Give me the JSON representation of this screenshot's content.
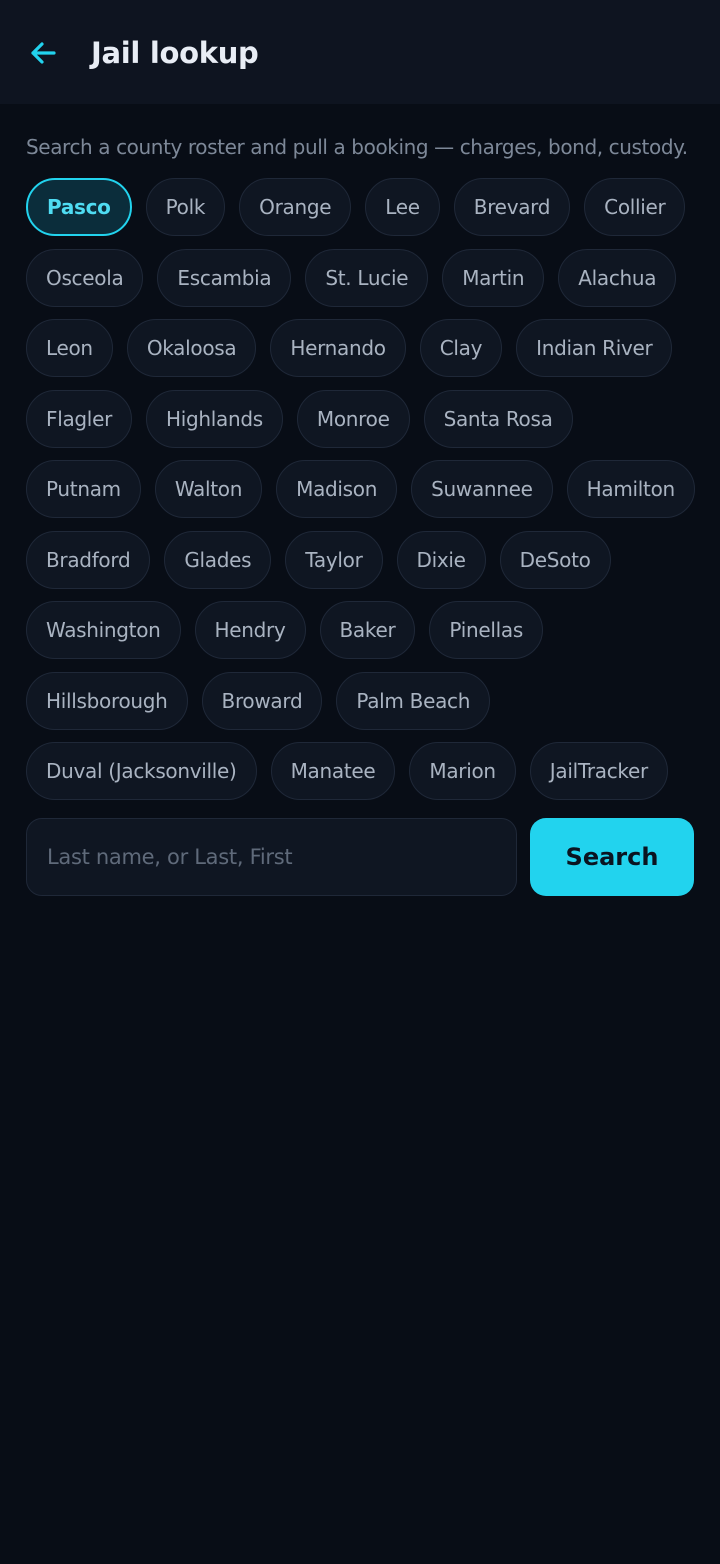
{
  "header": {
    "title": "Jail lookup",
    "back_icon": "arrow-left-icon",
    "accent_color": "#22d3ee"
  },
  "subtitle": "Search a county roster and pull a booking — charges, bond, custody.",
  "counties": {
    "selected": "Pasco",
    "rows": [
      [
        "Pasco",
        "Polk",
        "Orange",
        "Lee",
        "Brevard",
        "Collier"
      ],
      [
        "Osceola",
        "Escambia",
        "St. Lucie",
        "Martin",
        "Alachua"
      ],
      [
        "Leon",
        "Okaloosa",
        "Hernando",
        "Clay",
        "Indian River"
      ],
      [
        "Flagler",
        "Highlands",
        "Monroe",
        "Santa Rosa"
      ],
      [
        "Putnam",
        "Walton",
        "Madison",
        "Suwannee",
        "Hamilton"
      ],
      [
        "Bradford",
        "Glades",
        "Taylor",
        "Dixie",
        "DeSoto"
      ],
      [
        "Washington",
        "Hendry",
        "Baker",
        "Pinellas"
      ],
      [
        "Hillsborough",
        "Broward",
        "Palm Beach"
      ],
      [
        "Duval (Jacksonville)",
        "Manatee",
        "Marion",
        "JailTracker"
      ]
    ]
  },
  "search": {
    "placeholder": "Last name, or Last, First",
    "value": "",
    "button_label": "Search"
  }
}
